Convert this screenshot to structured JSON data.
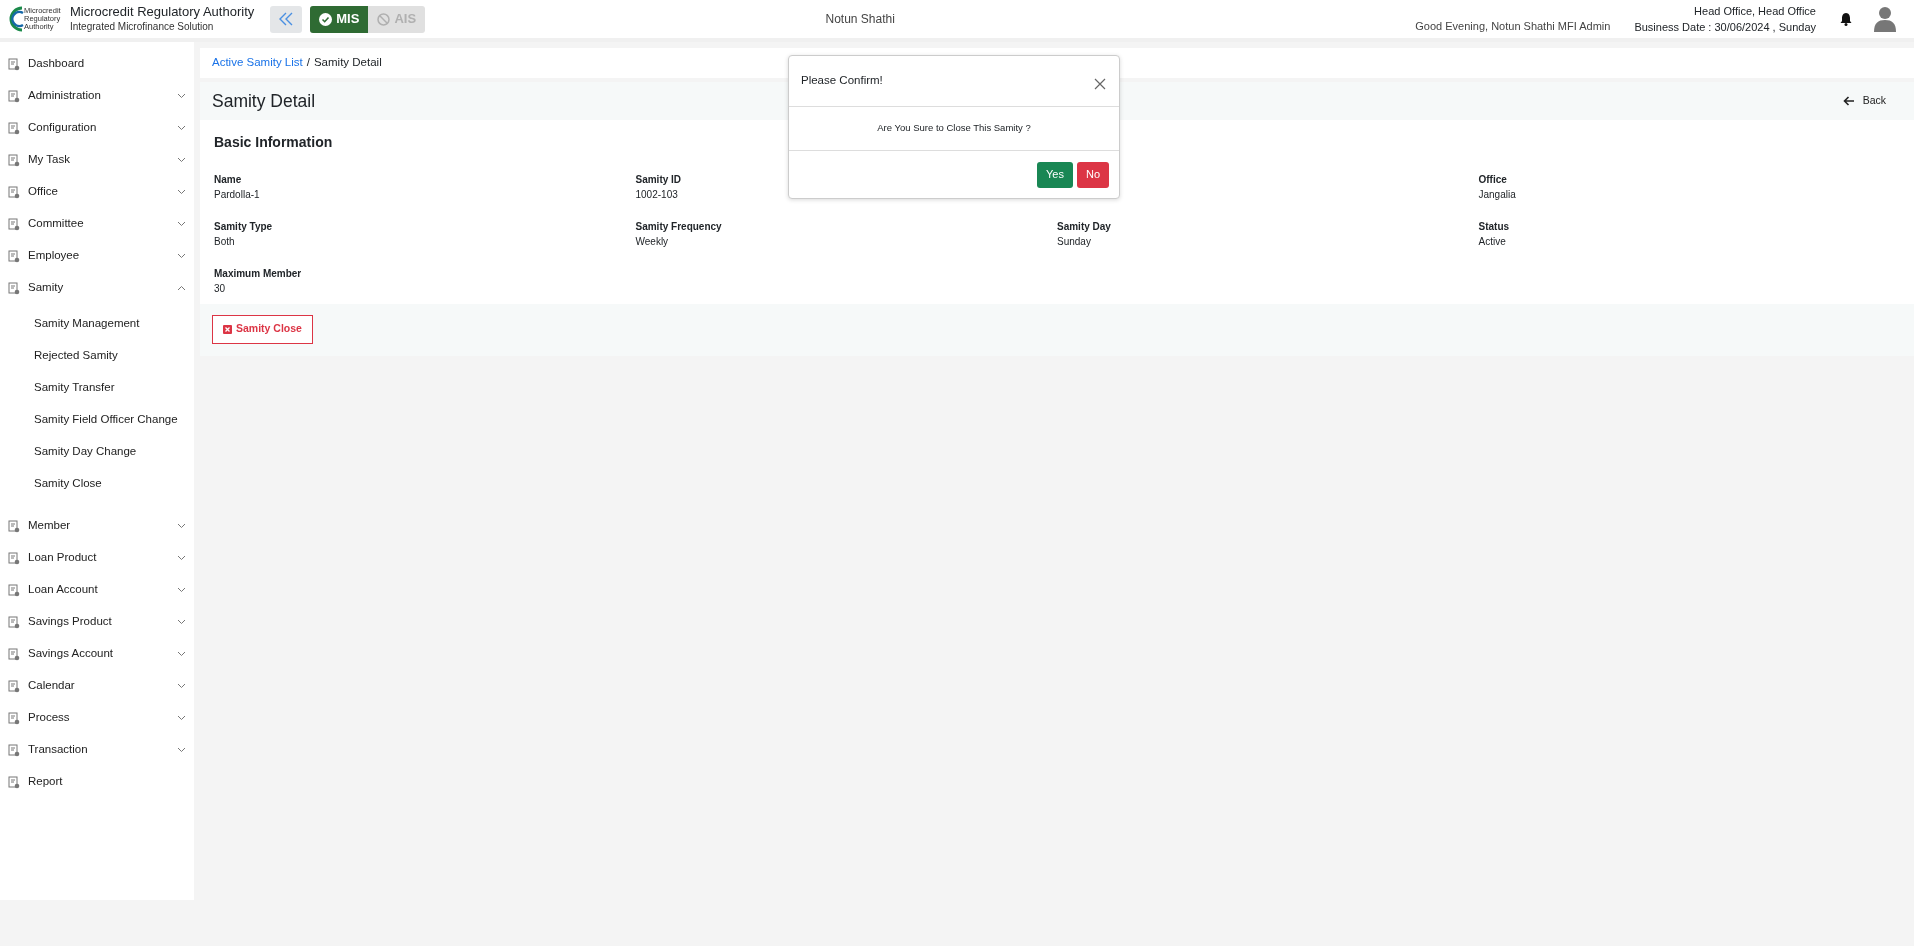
{
  "header": {
    "logo_text": [
      "Microcredit",
      "Regulatory",
      "Authority"
    ],
    "org_name": "Microcredit Regulatory Authority",
    "org_subtitle": "Integrated Microfinance Solution",
    "modules": [
      {
        "label": "MIS",
        "selected": true
      },
      {
        "label": "AIS",
        "selected": false
      }
    ],
    "center_title": "Notun Shathi",
    "greeting": "Good Evening, Notun Shathi MFI Admin",
    "office": "Head Office, Head Office",
    "business_date": "Business Date : 30/06/2024 , Sunday"
  },
  "sidebar": {
    "items": [
      {
        "label": "Dashboard",
        "kind": "link"
      },
      {
        "label": "Administration",
        "kind": "group",
        "expanded": false
      },
      {
        "label": "Configuration",
        "kind": "group",
        "expanded": false
      },
      {
        "label": "My Task",
        "kind": "group",
        "expanded": false
      },
      {
        "label": "Office",
        "kind": "group",
        "expanded": false
      },
      {
        "label": "Committee",
        "kind": "group",
        "expanded": false
      },
      {
        "label": "Employee",
        "kind": "group",
        "expanded": false
      },
      {
        "label": "Samity",
        "kind": "group",
        "expanded": true,
        "children": [
          {
            "label": "Samity Management"
          },
          {
            "label": "Rejected Samity"
          },
          {
            "label": "Samity Transfer"
          },
          {
            "label": "Samity Field Officer Change"
          },
          {
            "label": "Samity Day Change"
          },
          {
            "label": "Samity Close"
          }
        ]
      },
      {
        "label": "Member",
        "kind": "group",
        "expanded": false
      },
      {
        "label": "Loan Product",
        "kind": "group",
        "expanded": false
      },
      {
        "label": "Loan Account",
        "kind": "group",
        "expanded": false
      },
      {
        "label": "Savings Product",
        "kind": "group",
        "expanded": false
      },
      {
        "label": "Savings Account",
        "kind": "group",
        "expanded": false
      },
      {
        "label": "Calendar",
        "kind": "group",
        "expanded": false
      },
      {
        "label": "Process",
        "kind": "group",
        "expanded": false
      },
      {
        "label": "Transaction",
        "kind": "group",
        "expanded": false
      },
      {
        "label": "Report",
        "kind": "link"
      }
    ]
  },
  "breadcrumb": {
    "items": [
      {
        "label": "Active Samity List",
        "kind": "link"
      },
      {
        "label": "Samity Detail",
        "kind": "current"
      }
    ],
    "separator": "/"
  },
  "page": {
    "title": "Samity Detail",
    "back": "Back",
    "section_title": "Basic Information",
    "fields": [
      {
        "kind": "field",
        "label": "Name",
        "value": "Pardolla-1"
      },
      {
        "kind": "field",
        "label": "Samity ID",
        "value": "1002-103"
      },
      {
        "kind": "covered"
      },
      {
        "kind": "field",
        "label": "Office",
        "value": "Jangalia"
      },
      {
        "kind": "field",
        "label": "Samity Type",
        "value": "Both"
      },
      {
        "kind": "field",
        "label": "Samity Frequency",
        "value": "Weekly"
      },
      {
        "kind": "field",
        "label": "Samity Day",
        "value": "Sunday"
      },
      {
        "kind": "field",
        "label": "Status",
        "value": "Active"
      },
      {
        "kind": "field",
        "label": "Maximum Member",
        "value": "30"
      }
    ],
    "action": "Samity Close"
  },
  "dialog": {
    "title": "Please Confirm!",
    "message": "Are You Sure to Close This Samity ?",
    "buttons": [
      {
        "label": "Yes",
        "kind": "confirm"
      },
      {
        "label": "No",
        "kind": "cancel"
      }
    ]
  }
}
